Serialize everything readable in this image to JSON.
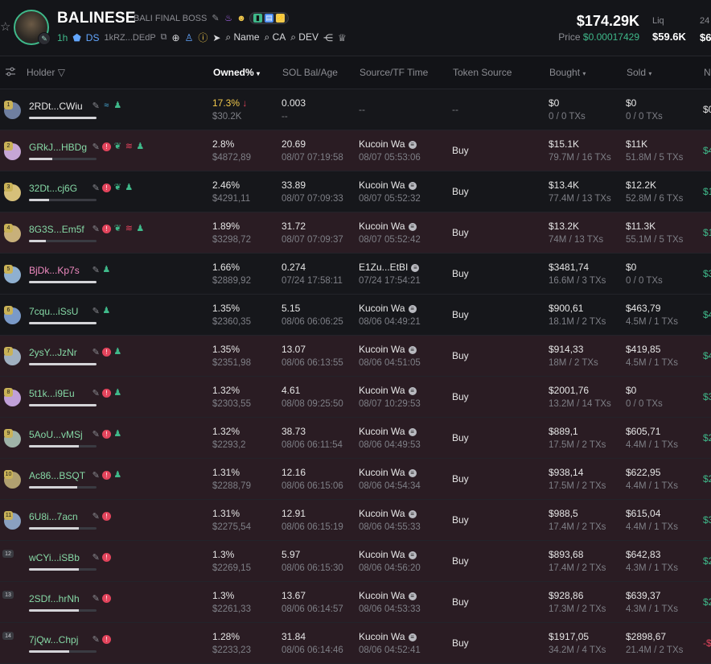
{
  "token": {
    "name": "BALINESE",
    "subtitle": "BALI FINAL BOSS",
    "age": "1h",
    "dex": "DS",
    "address": "1kRZ...DEdP",
    "links": {
      "name": "Name",
      "ca": "CA",
      "dev": "DEV"
    }
  },
  "metrics": {
    "market_cap": "$174.29K",
    "price_label": "Price",
    "price": "$0.00017429",
    "liq_label": "Liq",
    "liq": "$59.6K",
    "next_label": "24",
    "next_value": "$6"
  },
  "columns": {
    "holder": "Holder",
    "owned": "Owned%",
    "sol": "SOL Bal/Age",
    "source": "Source/TF Time",
    "token_source": "Token Source",
    "bought": "Bought",
    "sold": "Sold",
    "next": "N"
  },
  "colors": {
    "accent_green": "#3fb98a",
    "highlight_row": "#2a1c23",
    "alert_red": "#e2445c"
  },
  "rows": [
    {
      "rank": "1",
      "name": "2RDt...CWiu",
      "name_color": "#e6e6e6",
      "owned": "17.3%",
      "owned_arrow": "↓",
      "owned_usd": "$30.2K",
      "sol": "0.003",
      "sol_age": "--",
      "source": "--",
      "source_time": "",
      "token_source": "--",
      "bought": "$0",
      "bought_sub": "0 / 0 TXs",
      "sold": "$0",
      "sold_sub": "0 / 0 TXs",
      "edge": "$0",
      "bar": 1.0,
      "hl": false
    },
    {
      "rank": "2",
      "name": "GRkJ...HBDg",
      "name_color": "#86d9a6",
      "owned": "2.8%",
      "owned_usd": "$4872,89",
      "sol": "20.69",
      "sol_age": "08/07 07:19:58",
      "source": "Kucoin Wa",
      "source_time": "08/07 05:53:06",
      "token_source": "Buy",
      "bought": "$15.1K",
      "bought_sub": "79.7M / 16 TXs",
      "sold": "$11K",
      "sold_sub": "51.8M / 5 TXs",
      "edge": "$4",
      "bar": 0.35,
      "hl": true
    },
    {
      "rank": "3",
      "name": "32Dt...cj6G",
      "name_color": "#86d9a6",
      "owned": "2.46%",
      "owned_usd": "$4291,11",
      "sol": "33.89",
      "sol_age": "08/07 07:09:33",
      "source": "Kucoin Wa",
      "source_time": "08/07 05:52:32",
      "token_source": "Buy",
      "bought": "$13.4K",
      "bought_sub": "77.4M / 13 TXs",
      "sold": "$12.2K",
      "sold_sub": "52.8M / 6 TXs",
      "edge": "$1",
      "bar": 0.3,
      "hl": false
    },
    {
      "rank": "4",
      "name": "8G3S...Em5f",
      "name_color": "#86d9a6",
      "owned": "1.89%",
      "owned_usd": "$3298,72",
      "sol": "31.72",
      "sol_age": "08/07 07:09:37",
      "source": "Kucoin Wa",
      "source_time": "08/07 05:52:42",
      "token_source": "Buy",
      "bought": "$13.2K",
      "bought_sub": "74M / 13 TXs",
      "sold": "$11.3K",
      "sold_sub": "55.1M / 5 TXs",
      "edge": "$1",
      "bar": 0.25,
      "hl": true
    },
    {
      "rank": "5",
      "name": "BjDk...Kp7s",
      "name_color": "#f08ac0",
      "owned": "1.66%",
      "owned_usd": "$2889,92",
      "sol": "0.274",
      "sol_age": "07/24 17:58:11",
      "source": "E1Zu...EtBI",
      "source_time": "07/24 17:54:21",
      "token_source": "Buy",
      "bought": "$3481,74",
      "bought_sub": "16.6M / 3 TXs",
      "sold": "$0",
      "sold_sub": "0 / 0 TXs",
      "edge": "$3",
      "bar": 1.0,
      "hl": false
    },
    {
      "rank": "6",
      "name": "7cqu...iSsU",
      "name_color": "#86d9a6",
      "owned": "1.35%",
      "owned_usd": "$2360,35",
      "sol": "5.15",
      "sol_age": "08/06 06:06:25",
      "source": "Kucoin Wa",
      "source_time": "08/06 04:49:21",
      "token_source": "Buy",
      "bought": "$900,61",
      "bought_sub": "18.1M / 2 TXs",
      "sold": "$463,79",
      "sold_sub": "4.5M / 1 TXs",
      "edge": "$4",
      "bar": 1.0,
      "hl": false
    },
    {
      "rank": "7",
      "name": "2ysY...JzNr",
      "name_color": "#86d9a6",
      "owned": "1.35%",
      "owned_usd": "$2351,98",
      "sol": "13.07",
      "sol_age": "08/06 06:13:55",
      "source": "Kucoin Wa",
      "source_time": "08/06 04:51:05",
      "token_source": "Buy",
      "bought": "$914,33",
      "bought_sub": "18M / 2 TXs",
      "sold": "$419,85",
      "sold_sub": "4.5M / 1 TXs",
      "edge": "$4",
      "bar": 1.0,
      "hl": true
    },
    {
      "rank": "8",
      "name": "5t1k...i9Eu",
      "name_color": "#86d9a6",
      "owned": "1.32%",
      "owned_usd": "$2303,55",
      "sol": "4.61",
      "sol_age": "08/08 09:25:50",
      "source": "Kucoin Wa",
      "source_time": "08/07 10:29:53",
      "token_source": "Buy",
      "bought": "$2001,76",
      "bought_sub": "13.2M / 14 TXs",
      "sold": "$0",
      "sold_sub": "0 / 0 TXs",
      "edge": "$3",
      "bar": 1.0,
      "hl": true
    },
    {
      "rank": "9",
      "name": "5AoU...vMSj",
      "name_color": "#86d9a6",
      "owned": "1.32%",
      "owned_usd": "$2293,2",
      "sol": "38.73",
      "sol_age": "08/06 06:11:54",
      "source": "Kucoin Wa",
      "source_time": "08/06 04:49:53",
      "token_source": "Buy",
      "bought": "$889,1",
      "bought_sub": "17.5M / 2 TXs",
      "sold": "$605,71",
      "sold_sub": "4.4M / 1 TXs",
      "edge": "$2",
      "bar": 0.74,
      "hl": true
    },
    {
      "rank": "10",
      "name": "Ac86...BSQT",
      "name_color": "#86d9a6",
      "owned": "1.31%",
      "owned_usd": "$2288,79",
      "sol": "12.16",
      "sol_age": "08/06 06:15:06",
      "source": "Kucoin Wa",
      "source_time": "08/06 04:54:34",
      "token_source": "Buy",
      "bought": "$938,14",
      "bought_sub": "17.5M / 2 TXs",
      "sold": "$622,95",
      "sold_sub": "4.4M / 1 TXs",
      "edge": "$2",
      "bar": 0.72,
      "hl": true
    },
    {
      "rank": "11",
      "name": "6U8i...7acn",
      "name_color": "#86d9a6",
      "owned": "1.31%",
      "owned_usd": "$2275,54",
      "sol": "12.91",
      "sol_age": "08/06 06:15:19",
      "source": "Kucoin Wa",
      "source_time": "08/06 04:55:33",
      "token_source": "Buy",
      "bought": "$988,5",
      "bought_sub": "17.4M / 2 TXs",
      "sold": "$615,04",
      "sold_sub": "4.4M / 1 TXs",
      "edge": "$3",
      "bar": 0.74,
      "hl": true
    },
    {
      "rank": "12",
      "name": "wCYi...iSBb",
      "name_color": "#86d9a6",
      "owned": "1.3%",
      "owned_usd": "$2269,15",
      "sol": "5.97",
      "sol_age": "08/06 06:15:30",
      "source": "Kucoin Wa",
      "source_time": "08/06 04:56:20",
      "token_source": "Buy",
      "bought": "$893,68",
      "bought_sub": "17.4M / 2 TXs",
      "sold": "$642,83",
      "sold_sub": "4.3M / 1 TXs",
      "edge": "$2",
      "bar": 0.74,
      "hl": true
    },
    {
      "rank": "13",
      "name": "2SDf...hrNh",
      "name_color": "#86d9a6",
      "owned": "1.3%",
      "owned_usd": "$2261,33",
      "sol": "13.67",
      "sol_age": "08/06 06:14:57",
      "source": "Kucoin Wa",
      "source_time": "08/06 04:53:33",
      "token_source": "Buy",
      "bought": "$928,86",
      "bought_sub": "17.3M / 2 TXs",
      "sold": "$639,37",
      "sold_sub": "4.3M / 1 TXs",
      "edge": "$2",
      "bar": 0.74,
      "hl": true
    },
    {
      "rank": "14",
      "name": "7jQw...Chpj",
      "name_color": "#86d9a6",
      "owned": "1.28%",
      "owned_usd": "$2233,23",
      "sol": "31.84",
      "sol_age": "08/06 06:14:46",
      "source": "Kucoin Wa",
      "source_time": "08/06 04:52:41",
      "token_source": "Buy",
      "bought": "$1917,05",
      "bought_sub": "34.2M / 4 TXs",
      "sold": "$2898,67",
      "sold_sub": "21.4M / 2 TXs",
      "edge": "-$",
      "bar": 0.6,
      "hl": true
    }
  ]
}
